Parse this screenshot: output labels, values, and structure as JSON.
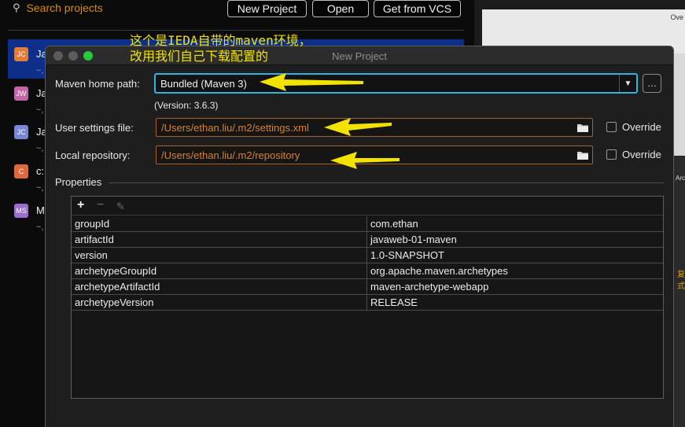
{
  "welcome": {
    "search_placeholder": "Search projects",
    "buttons": {
      "new_project": "New Project",
      "open": "Open",
      "vcs": "Get from VCS"
    },
    "recent": [
      {
        "initials": "JC",
        "name": "Ja",
        "sub": "~,",
        "color": "#e07b39"
      },
      {
        "initials": "JW",
        "name": "Ja",
        "sub": "~,",
        "color": "#c266a8"
      },
      {
        "initials": "JC",
        "name": "Ja",
        "sub": "~,",
        "color": "#7a86d6"
      },
      {
        "initials": "C",
        "name": "c:",
        "sub": "~,",
        "color": "#e0683a"
      },
      {
        "initials": "MS",
        "name": "M",
        "sub": "~,",
        "color": "#9b6fd0"
      }
    ]
  },
  "background_right": {
    "text_top": "Ove",
    "text_side": "Arch",
    "text_yellow": "复式"
  },
  "annotation": {
    "line1": "这个是IEDA自带的maven环境，",
    "line2": "改用我们自己下载配置的"
  },
  "dialog": {
    "title": "New Project",
    "maven_home_label": "Maven home path:",
    "maven_home_value": "Bundled (Maven 3)",
    "version_text": "(Version: 3.6.3)",
    "user_settings_label": "User settings file:",
    "user_settings_value": "/Users/ethan.liu/.m2/settings.xml",
    "local_repo_label": "Local repository:",
    "local_repo_value": "/Users/ethan.liu/.m2/repository",
    "override_label": "Override",
    "properties_title": "Properties",
    "properties": [
      {
        "key": "groupId",
        "value": "com.ethan"
      },
      {
        "key": "artifactId",
        "value": "javaweb-01-maven"
      },
      {
        "key": "version",
        "value": "1.0-SNAPSHOT"
      },
      {
        "key": "archetypeGroupId",
        "value": "org.apache.maven.archetypes"
      },
      {
        "key": "archetypeArtifactId",
        "value": "maven-archetype-webapp"
      },
      {
        "key": "archetypeVersion",
        "value": "RELEASE"
      }
    ]
  },
  "colors": {
    "accent_focus": "#2fb4e0",
    "path_text": "#d9822b",
    "annotation": "#f2e200",
    "selection": "#0d2f8a"
  }
}
